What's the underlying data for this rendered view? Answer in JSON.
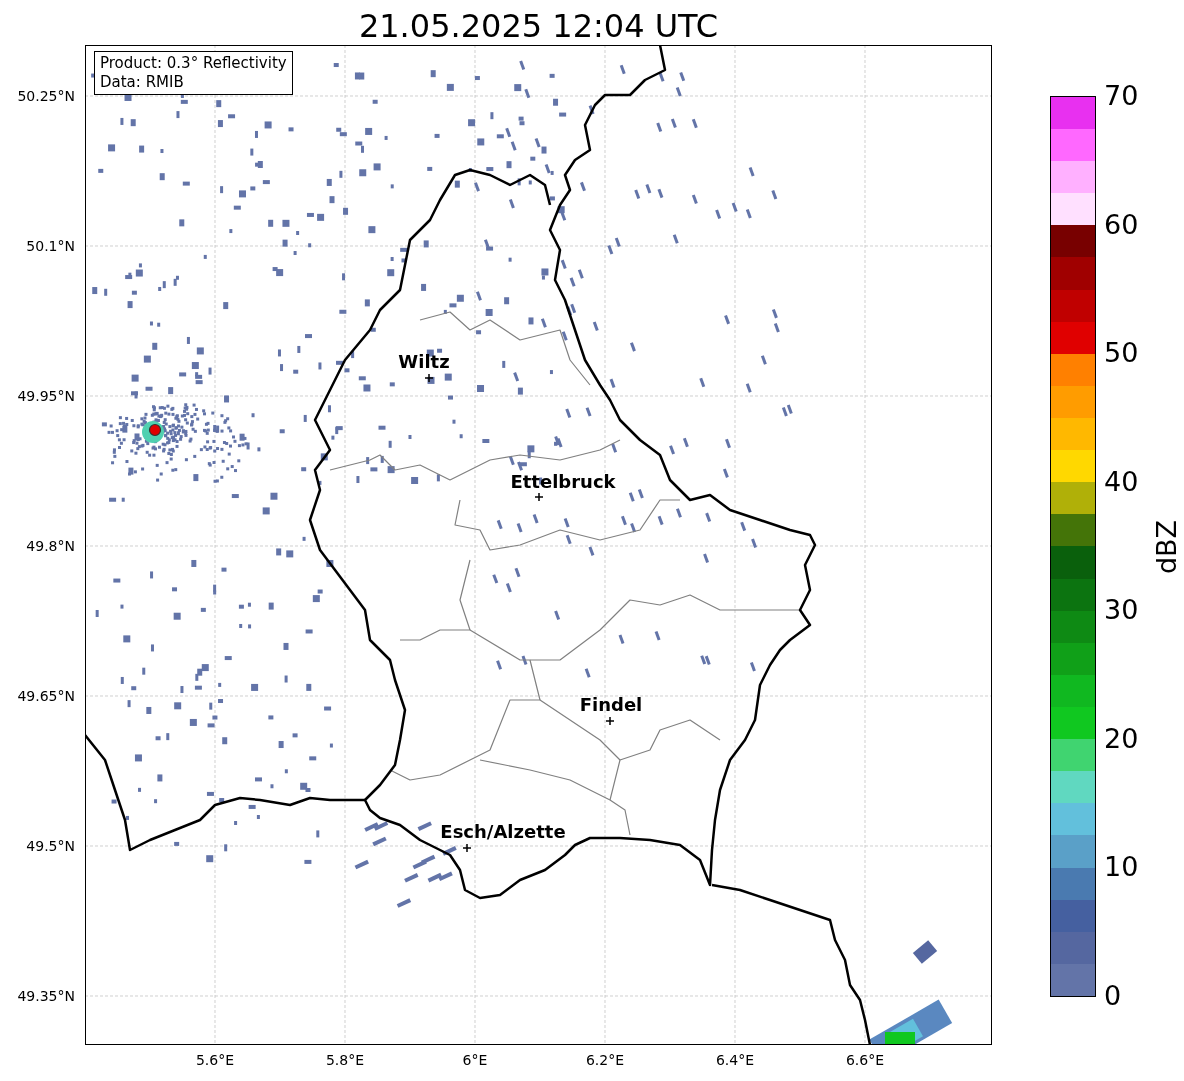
{
  "title": "21.05.2025 12:04 UTC",
  "info_box": {
    "lines": [
      "Product: 0.3° Reflectivity",
      "Data: RMIB"
    ]
  },
  "map": {
    "lat_ticks": [
      "50.25°N",
      "50.1°N",
      "49.95°N",
      "49.8°N",
      "49.65°N",
      "49.5°N",
      "49.35°N"
    ],
    "lon_ticks": [
      "5.6°E",
      "5.8°E",
      "6°E",
      "6.2°E",
      "6.4°E",
      "6.6°E"
    ],
    "cities": [
      {
        "name": "Wiltz"
      },
      {
        "name": "Ettelbruck"
      },
      {
        "name": "Findel"
      },
      {
        "name": "Esch/Alzette"
      }
    ]
  },
  "colorbar": {
    "label": "dBZ",
    "ticks": [
      "70",
      "60",
      "50",
      "40",
      "30",
      "20",
      "10",
      "0"
    ],
    "segments": [
      {
        "color": "#6374a8"
      },
      {
        "color": "#5567a0"
      },
      {
        "color": "#4560a0"
      },
      {
        "color": "#4a7ab0"
      },
      {
        "color": "#5aa0c8"
      },
      {
        "color": "#62c0dc"
      },
      {
        "color": "#60d8c0"
      },
      {
        "color": "#40d470"
      },
      {
        "color": "#10c820"
      },
      {
        "color": "#10b820"
      },
      {
        "color": "#10a018"
      },
      {
        "color": "#0e8a14"
      },
      {
        "color": "#0c7410"
      },
      {
        "color": "#0a600c"
      },
      {
        "color": "#447408"
      },
      {
        "color": "#b0b008"
      },
      {
        "color": "#ffd800"
      },
      {
        "color": "#ffb800"
      },
      {
        "color": "#ff9c00"
      },
      {
        "color": "#ff8000"
      },
      {
        "color": "#e00000"
      },
      {
        "color": "#c00000"
      },
      {
        "color": "#a00000"
      },
      {
        "color": "#780000"
      },
      {
        "color": "#ffe0ff"
      },
      {
        "color": "#ffb0ff"
      },
      {
        "color": "#ff68ff"
      },
      {
        "color": "#e830f0"
      }
    ]
  }
}
